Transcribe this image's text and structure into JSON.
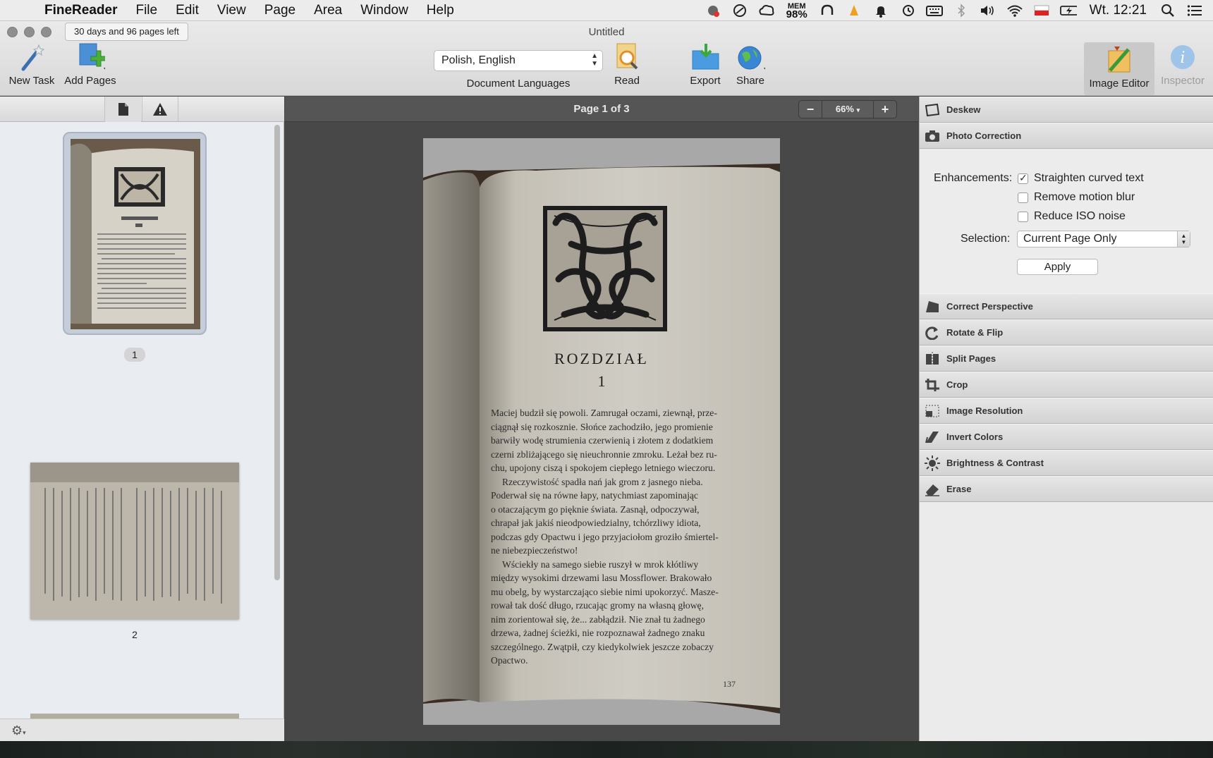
{
  "menubar": {
    "app_name": "FineReader",
    "menus": [
      "File",
      "Edit",
      "View",
      "Page",
      "Area",
      "Window",
      "Help"
    ],
    "mem_label": "MEM",
    "mem_value": "98%",
    "clock": "Wt. 12:21"
  },
  "window": {
    "title": "Untitled",
    "trial_badge": "30 days and 96 pages left"
  },
  "toolbar": {
    "new_task": "New Task",
    "add_pages": "Add Pages",
    "language_value": "Polish, English",
    "language_label": "Document Languages",
    "read": "Read",
    "export": "Export",
    "share": "Share",
    "image_editor": "Image Editor",
    "inspector": "Inspector"
  },
  "sidebar": {
    "pages": [
      {
        "label": "1",
        "selected": true
      },
      {
        "label": "2",
        "selected": false
      }
    ]
  },
  "viewer": {
    "page_indicator": "Page 1 of 3",
    "zoom": "66%",
    "zoom_out": "−",
    "zoom_in": "+"
  },
  "book_page": {
    "chapter_title": "ROZDZIAŁ",
    "chapter_number": "1",
    "paragraphs": [
      "Maciej budził się powoli. Zamrugał oczami, ziewnął, prze-",
      "ciągnął się rozkosznie. Słońce zachodziło, jego promienie",
      "barwiły wodę strumienia czerwienią i złotem z dodatkiem",
      "czerni zbliżającego się nieuchronnie zmroku. Leżał bez ru-",
      "chu, upojony ciszą i spokojem ciepłego letniego wieczoru.",
      "Rzeczywistość spadła nań jak grom z jasnego nieba.",
      "Poderwał się na równe łapy, natychmiast zapominając",
      "o otaczającym go pięknie świata. Zasnął, odpoczywał,",
      "chrapał jak jakiś nieodpowiedzialny, tchórzliwy idiota,",
      "podczas gdy Opactwu i jego przyjaciołom groziło śmiertel-",
      "ne niebezpieczeństwo!",
      "Wściekły na samego siebie ruszył w mrok kłótliwy",
      "między wysokimi drzewami lasu Mossflower. Brakowało",
      "mu obelg, by wystarczająco siebie nimi upokorzyć. Masze-",
      "rował tak dość długo, rzucając gromy na własną głowę,",
      "nim zorientował się, że... zabłądził. Nie znał tu żadnego",
      "drzewa, żadnej ścieżki, nie rozpoznawał żadnego znaku",
      "szczególnego. Zwątpił, czy kiedykolwiek jeszcze zobaczy",
      "Opactwo."
    ],
    "page_number": "137"
  },
  "panel": {
    "sections_top": [
      {
        "label": "Deskew",
        "icon": "deskew-icon"
      },
      {
        "label": "Photo Correction",
        "icon": "camera-icon"
      }
    ],
    "photo_correction": {
      "enhancements_label": "Enhancements:",
      "options": [
        {
          "label": "Straighten curved text",
          "checked": true
        },
        {
          "label": "Remove motion blur",
          "checked": false
        },
        {
          "label": "Reduce ISO noise",
          "checked": false
        }
      ],
      "selection_label": "Selection:",
      "selection_value": "Current Page Only",
      "apply": "Apply"
    },
    "sections_bottom": [
      {
        "label": "Correct Perspective",
        "icon": "perspective-icon"
      },
      {
        "label": "Rotate & Flip",
        "icon": "rotate-icon"
      },
      {
        "label": "Split Pages",
        "icon": "split-icon"
      },
      {
        "label": "Crop",
        "icon": "crop-icon"
      },
      {
        "label": "Image Resolution",
        "icon": "resolution-icon"
      },
      {
        "label": "Invert Colors",
        "icon": "invert-icon"
      },
      {
        "label": "Brightness & Contrast",
        "icon": "brightness-icon"
      },
      {
        "label": "Erase",
        "icon": "eraser-icon"
      }
    ]
  },
  "colors": {
    "accent_blue": "#3a86d4",
    "add_green": "#4caf3c",
    "read_orange": "#e8a027"
  }
}
